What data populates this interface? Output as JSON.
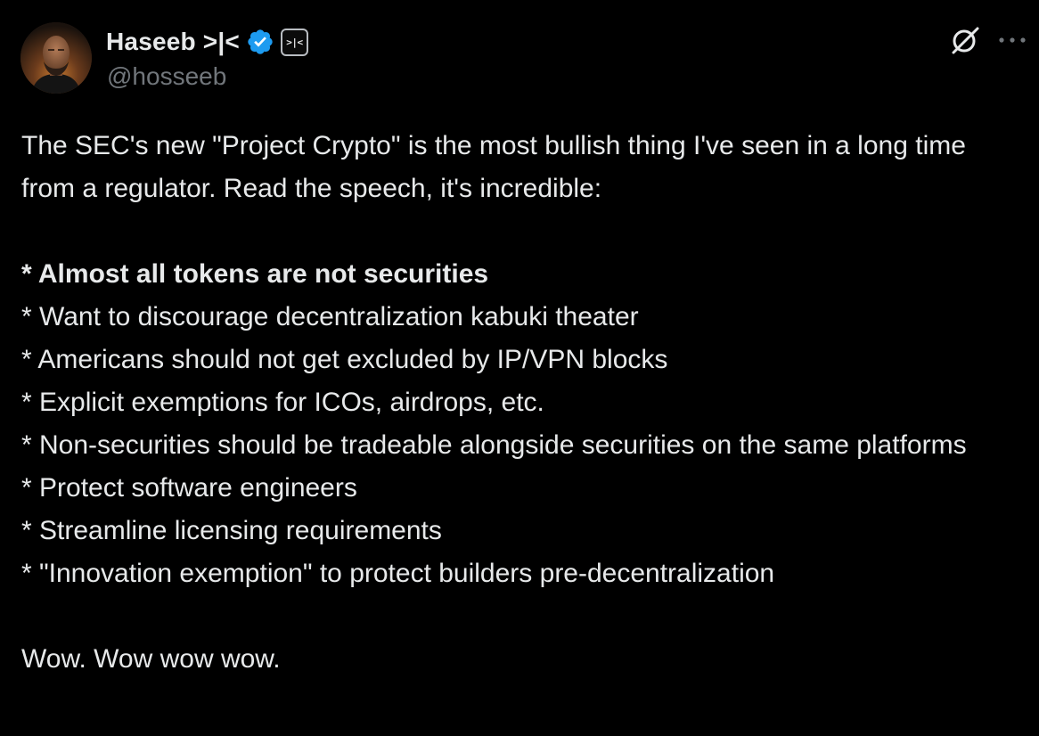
{
  "author": {
    "display_name": "Haseeb >|<",
    "handle": "@hosseeb",
    "affiliation_badge": ">|<"
  },
  "tweet": {
    "intro": "The SEC's new \"Project Crypto\" is the most bullish thing I've seen in a long time from a regulator. Read the speech, it's incredible:",
    "bullets": [
      "* Almost all tokens are not securities",
      "* Want to discourage decentralization kabuki theater",
      "* Americans should not get excluded by IP/VPN blocks",
      "* Explicit exemptions  for ICOs, airdrops, etc.",
      "* Non-securities should be tradeable alongside securities on the same platforms",
      "* Protect software engineers",
      "* Streamline licensing requirements",
      "* \"Innovation exemption\" to protect builders pre-decentralization"
    ],
    "outro": "Wow. Wow wow wow."
  },
  "colors": {
    "background": "#000000",
    "text": "#e7e9ea",
    "muted": "#71767b",
    "verified": "#1d9bf0"
  },
  "icons": [
    "verified-badge-icon",
    "grok-icon",
    "more-options-icon"
  ]
}
